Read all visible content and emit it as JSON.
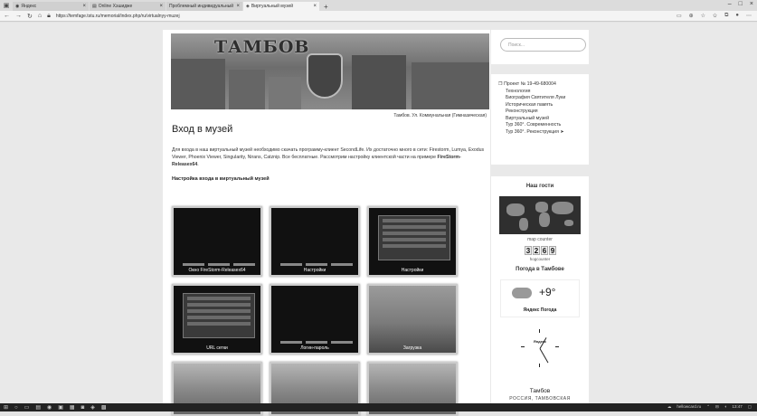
{
  "browser": {
    "tabs": [
      {
        "label": "Яндекс",
        "active": false
      },
      {
        "label": "Online Хэшидже",
        "active": false
      },
      {
        "label": "Проблемный индивидуальный",
        "active": false
      },
      {
        "label": "Виртуальный музей",
        "active": true
      }
    ],
    "new_tab": "+",
    "address": "https://temfage.tstu.ru/memorial/index.php/ru/virtualnyy-muzej"
  },
  "header": {
    "banner_title": "ТАМБОВ",
    "banner_caption": "Тамбов. Ул. Коммунальная (Гимназическая)"
  },
  "main": {
    "title": "Вход в музей",
    "paragraph_start": "Для входа в наш виртуальный музей необходимо скачать программу-клиент SecondLife. Их достаточно много в сети: Firestorm, Lumya, Exodus Viewer, Phoenix Viewer, Singularity, Nirans, Catznip. Все бесплатные. Рассмотрим настройку клиентской части на примере ",
    "paragraph_bold": "FireStorm-Releasex64",
    "paragraph_end": ".",
    "subtitle": "Настройка входа в виртуальный музей",
    "thumbnails": [
      {
        "label": "Окно FireStorm-Releasex64"
      },
      {
        "label": "Настройки"
      },
      {
        "label": "Настройки"
      },
      {
        "label": "URL сетки"
      },
      {
        "label": "Логин-пароль"
      },
      {
        "label": "Загрузка"
      },
      {
        "label": ""
      },
      {
        "label": ""
      },
      {
        "label": ""
      }
    ]
  },
  "sidebar": {
    "search_placeholder": "Поиск...",
    "menu": [
      {
        "label": "❐ Проект № 19-49-680004",
        "indent": false
      },
      {
        "label": "Технология",
        "indent": true
      },
      {
        "label": "Биография Святителя Луки",
        "indent": true
      },
      {
        "label": "Историческая память",
        "indent": true
      },
      {
        "label": "Реконструкция",
        "indent": true
      },
      {
        "label": "Виртуальный музей",
        "indent": true
      },
      {
        "label": "Тур 360°. Современность",
        "indent": true
      },
      {
        "label": "Тур 360°. Реконструкция ➤",
        "indent": true
      }
    ],
    "guests_title": "Наш гости",
    "map_counter": "map counter",
    "counter_digits": [
      "3",
      "2",
      "6",
      "9"
    ],
    "counter_label": "hogcounter",
    "weather_title": "Погода в Тамбове",
    "weather_temp": "+9°",
    "weather_brand": "Яндекс Погода",
    "clock_brand": "Яндекс",
    "city": "Тамбов",
    "region": "РОССИЯ, ТАМБОВСКАЯ"
  },
  "taskbar": {
    "tray_text": "hellowcard.ru",
    "time": "13:47"
  },
  "colors": {
    "page_bg": "#e9e9e9",
    "content_bg": "#ffffff",
    "taskbar": "#222222"
  }
}
